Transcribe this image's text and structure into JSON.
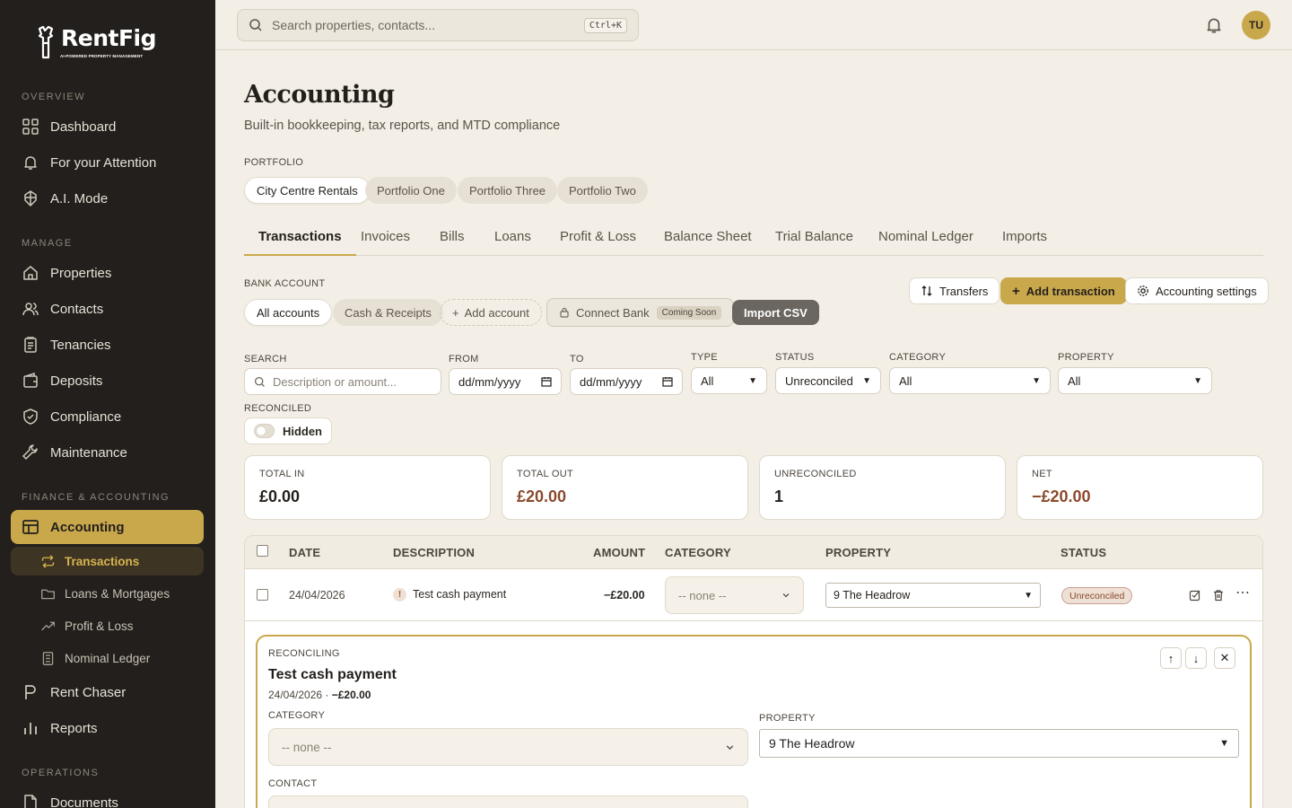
{
  "brand": {
    "name": "RentFig",
    "tagline": "AI-POWERED PROPERTY MANAGEMENT",
    "accent": "#c9a84c"
  },
  "sidebar": {
    "sections": {
      "overview": "OVERVIEW",
      "manage": "MANAGE",
      "finance": "FINANCE & ACCOUNTING",
      "operations": "OPERATIONS"
    },
    "items": {
      "dashboard": "Dashboard",
      "attention": "For your Attention",
      "ai_mode": "A.I. Mode",
      "properties": "Properties",
      "contacts": "Contacts",
      "tenancies": "Tenancies",
      "deposits": "Deposits",
      "compliance": "Compliance",
      "maintenance": "Maintenance",
      "accounting": "Accounting",
      "transactions": "Transactions",
      "loans": "Loans & Mortgages",
      "pnl": "Profit & Loss",
      "nominal": "Nominal Ledger",
      "rent_chaser": "Rent Chaser",
      "reports": "Reports",
      "documents": "Documents"
    }
  },
  "topbar": {
    "search_placeholder": "Search properties, contacts...",
    "shortcut": "Ctrl+K",
    "avatar_initials": "TU"
  },
  "page": {
    "title": "Accounting",
    "subtitle": "Built-in bookkeeping, tax reports, and MTD compliance"
  },
  "portfolio": {
    "label": "PORTFOLIO",
    "options": [
      "City Centre Rentals",
      "Portfolio One",
      "Portfolio Three",
      "Portfolio Two"
    ],
    "selected": "City Centre Rentals"
  },
  "tabs": [
    "Transactions",
    "Invoices",
    "Bills",
    "Loans",
    "Profit & Loss",
    "Balance Sheet",
    "Trial Balance",
    "Nominal Ledger",
    "Imports"
  ],
  "bank": {
    "label": "BANK ACCOUNT",
    "all": "All accounts",
    "cash": "Cash & Receipts",
    "add": "Add account",
    "connect": "Connect Bank",
    "coming_soon": "Coming Soon",
    "import": "Import CSV"
  },
  "actions": {
    "transfers": "Transfers",
    "add_transaction": "Add transaction",
    "settings": "Accounting settings"
  },
  "filters": {
    "search_label": "SEARCH",
    "search_placeholder": "Description or amount...",
    "from_label": "FROM",
    "from_value": "dd/mm/yyyy",
    "to_label": "TO",
    "to_value": "dd/mm/yyyy",
    "type_label": "TYPE",
    "type_value": "All",
    "status_label": "STATUS",
    "status_value": "Unreconciled",
    "category_label": "CATEGORY",
    "category_value": "All",
    "property_label": "PROPERTY",
    "property_value": "All",
    "reconciled_label": "RECONCILED",
    "reconciled_value": "Hidden"
  },
  "stats": [
    {
      "label": "TOTAL IN",
      "value": "£0.00",
      "color": "#231f1b"
    },
    {
      "label": "TOTAL OUT",
      "value": "£20.00",
      "color": "#8a4a2a"
    },
    {
      "label": "UNRECONCILED",
      "value": "1",
      "color": "#231f1b"
    },
    {
      "label": "NET",
      "value": "−£20.00",
      "color": "#8a4a2a"
    }
  ],
  "table": {
    "headers": {
      "date": "DATE",
      "description": "DESCRIPTION",
      "amount": "AMOUNT",
      "category": "CATEGORY",
      "property": "PROPERTY",
      "status": "STATUS"
    },
    "rows": [
      {
        "date": "24/04/2026",
        "description": "Test cash payment",
        "amount": "−£20.00",
        "category": "-- none --",
        "property": "9 The Headrow",
        "status": "Unreconciled"
      }
    ]
  },
  "reconcile": {
    "label": "RECONCILING",
    "title": "Test cash payment",
    "date": "24/04/2026",
    "amount": "−£20.00",
    "category_label": "CATEGORY",
    "category_value": "-- none --",
    "property_label": "PROPERTY",
    "property_value": "9 The Headrow",
    "contact_label": "CONTACT"
  }
}
